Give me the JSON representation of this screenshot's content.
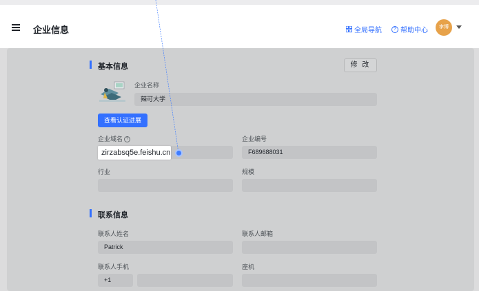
{
  "header": {
    "title": "企业信息",
    "global_nav": "全局导航",
    "help_center": "帮助中心",
    "avatar_text": "李博"
  },
  "basic": {
    "section_title": "基本信息",
    "edit_button": "修 改",
    "company_name_label": "企业名称",
    "company_name_value": "辣可大学",
    "verify_button": "查看认证进展",
    "domain_label": "企业域名",
    "domain_help_icon": "?",
    "domain_value": "zirzabsq5e.feishu.cn",
    "company_id_label": "企业编号",
    "company_id_value": "F689688031",
    "industry_label": "行业",
    "industry_value": "",
    "scale_label": "规模",
    "scale_value": ""
  },
  "contact": {
    "section_title": "联系信息",
    "name_label": "联系人姓名",
    "name_value": "Patrick",
    "email_label": "联系人邮箱",
    "email_value": "",
    "phone_label": "联系人手机",
    "phone_code": "+1",
    "phone_value": "",
    "landline_label": "座机",
    "landline_value": ""
  },
  "colors": {
    "accent": "#3370ff",
    "avatar": "#e7a24a"
  },
  "icons": [
    "menu-icon",
    "grid-icon",
    "help-icon",
    "chevron-down-icon",
    "question-icon",
    "company-logo-icon",
    "cursor-dot"
  ]
}
